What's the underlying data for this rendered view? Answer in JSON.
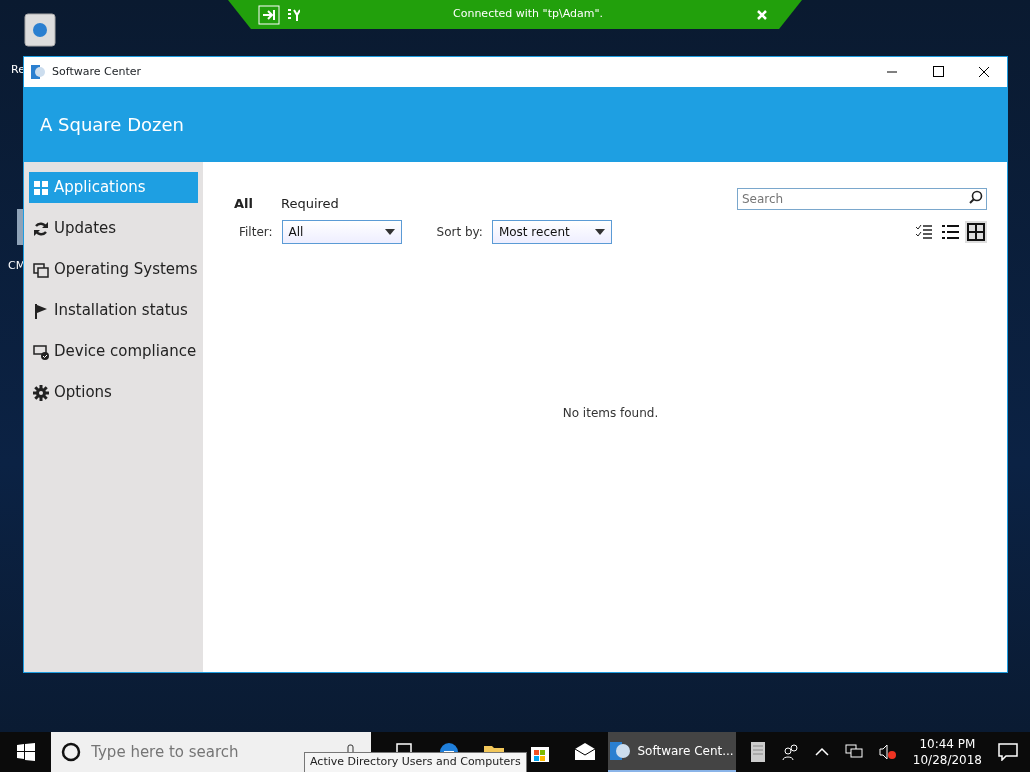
{
  "desktop_icons": [
    {
      "label": "Re",
      "kind": "recycle"
    },
    {
      "label": "CM",
      "kind": "computer"
    }
  ],
  "rdp_bar": {
    "title": "Connected with \"tp\\Adam\"."
  },
  "window": {
    "title": "Software Center",
    "header": "A Square Dozen"
  },
  "sidebar": {
    "items": [
      {
        "label": "Applications",
        "selected": true
      },
      {
        "label": "Updates",
        "selected": false
      },
      {
        "label": "Operating Systems",
        "selected": false
      },
      {
        "label": "Installation status",
        "selected": false
      },
      {
        "label": "Device compliance",
        "selected": false
      },
      {
        "label": "Options",
        "selected": false
      }
    ]
  },
  "tabs": [
    {
      "label": "All",
      "selected": true
    },
    {
      "label": "Required",
      "selected": false
    }
  ],
  "search": {
    "placeholder": "Search"
  },
  "filter": {
    "label": "Filter:",
    "value": "All"
  },
  "sort": {
    "label": "Sort by:",
    "value": "Most recent"
  },
  "views": [
    {
      "selected": false
    },
    {
      "selected": false
    },
    {
      "selected": true
    }
  ],
  "empty_message": "No items found.",
  "taskbar": {
    "search_placeholder": "Type here to search",
    "apps": [
      {
        "selected": false
      },
      {
        "selected": false
      },
      {
        "selected": false
      },
      {
        "selected": false
      },
      {
        "selected": false
      },
      {
        "label": "Software Cent...",
        "selected": true
      },
      {
        "selected": false
      }
    ],
    "tooltip": "Active Directory Users and Computers",
    "time": "10:44 PM",
    "date": "10/28/2018"
  }
}
